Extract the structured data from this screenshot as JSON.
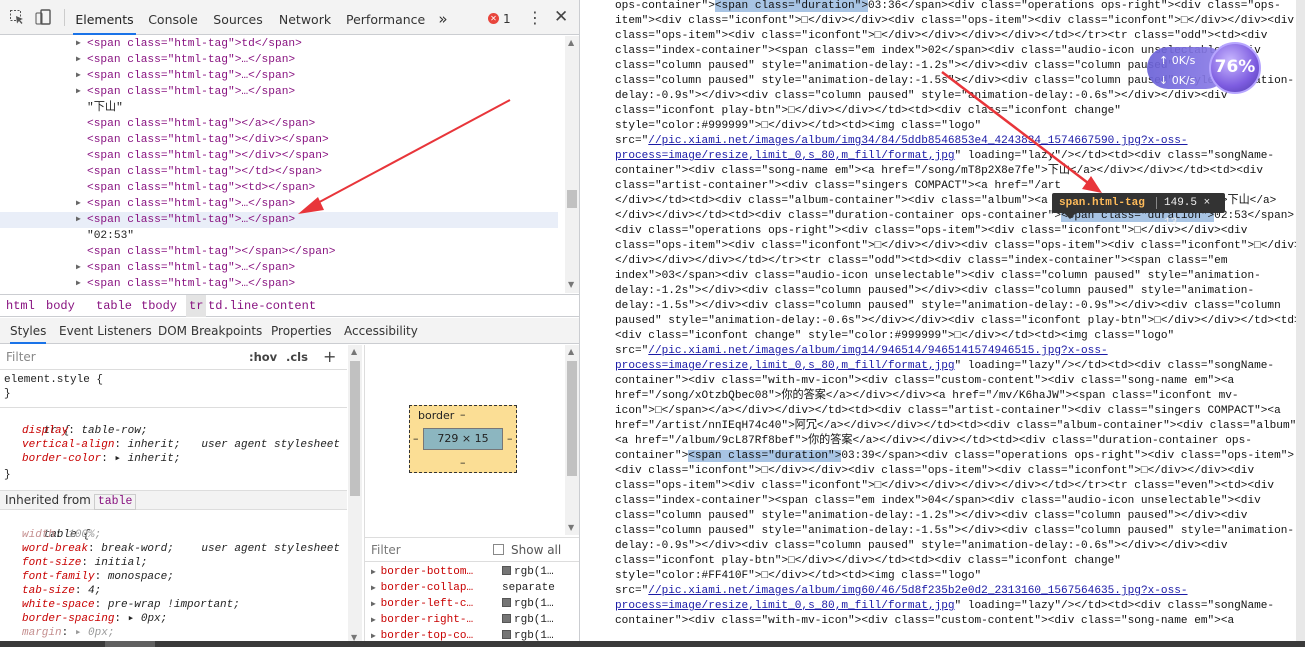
{
  "toolbar": {
    "inspect_icon": "cursor-select-icon",
    "device_icon": "device-toggle-icon",
    "tabs": [
      "Elements",
      "Console",
      "Sources",
      "Network",
      "Performance"
    ],
    "more": "»",
    "error_count": "1",
    "error_glyph": "✕",
    "menu": "⋮",
    "close": "✕"
  },
  "elements": {
    "rows": [
      {
        "tri": "▶",
        "text": "<span class=\"html-tag\">td</span>"
      },
      {
        "tri": "▶",
        "text": "<span class=\"html-tag\">…</span>"
      },
      {
        "tri": "▶",
        "text": "<span class=\"html-tag\">…</span>"
      },
      {
        "tri": "▶",
        "text": "<span class=\"html-tag\">…</span>"
      },
      {
        "tri": "",
        "text": "\"下山\""
      },
      {
        "tri": "",
        "text": "<span class=\"html-tag\"></a></span>"
      },
      {
        "tri": "",
        "text": "<span class=\"html-tag\"></div></span>"
      },
      {
        "tri": "",
        "text": "<span class=\"html-tag\"></div></span>"
      },
      {
        "tri": "",
        "text": "<span class=\"html-tag\"></td></span>"
      },
      {
        "tri": "",
        "text": "<span class=\"html-tag\"><td></span>"
      },
      {
        "tri": "▶",
        "text": "<span class=\"html-tag\">…</span>"
      },
      {
        "tri": "▶",
        "text": "<span class=\"html-tag\">…</span>"
      },
      {
        "tri": "",
        "text": "\"02:53\""
      },
      {
        "tri": "",
        "text": "<span class=\"html-tag\"></span></span>"
      },
      {
        "tri": "▶",
        "text": "<span class=\"html-tag\">…</span>"
      },
      {
        "tri": "▶",
        "text": "<span class=\"html-tag\">…</span>"
      }
    ],
    "selected_index": 11
  },
  "breadcrumbs": [
    "html",
    "body",
    "table",
    "tbody",
    "tr",
    "td.line-content"
  ],
  "breadcrumb_selected": 4,
  "subtabs": [
    "Styles",
    "Event Listeners",
    "DOM Breakpoints",
    "Properties",
    "Accessibility"
  ],
  "styles": {
    "filter_placeholder": "Filter",
    "hov": ":hov",
    "cls": ".cls",
    "plus": "+",
    "element_style_open": "element.style {",
    "close_brace": "}",
    "tr_rule": {
      "selector": "tr {",
      "source": "user agent stylesheet",
      "props": [
        {
          "name": "display",
          "value": "table-row;"
        },
        {
          "name": "vertical-align",
          "value": "inherit;"
        },
        {
          "name": "border-color",
          "value": "▸ inherit;"
        }
      ]
    },
    "inherited_from_label": "Inherited from",
    "inherited_from_tag": "table",
    "table_rule": {
      "selector": "table {",
      "source": "user agent stylesheet",
      "props": [
        {
          "name": "width",
          "value": "100%;",
          "disabled": true
        },
        {
          "name": "word-break",
          "value": "break-word;"
        },
        {
          "name": "font-size",
          "value": "initial;"
        },
        {
          "name": "font-family",
          "value": "monospace;"
        },
        {
          "name": "tab-size",
          "value": "4;"
        },
        {
          "name": "white-space",
          "value": "pre-wrap !important;"
        },
        {
          "name": "border-spacing",
          "value": "▸ 0px;"
        },
        {
          "name": "margin",
          "value": "▸ 0px;",
          "disabled": true
        }
      ]
    }
  },
  "box_model": {
    "label": "border",
    "dash": "–",
    "content": "729 × 15"
  },
  "computed": {
    "filter_placeholder": "Filter",
    "show_all": "Show all",
    "props": [
      {
        "name": "border-bottom…",
        "value": "rgb(1…",
        "swatch": true
      },
      {
        "name": "border-collap…",
        "value": "separate",
        "swatch": false
      },
      {
        "name": "border-left-c…",
        "value": "rgb(1…",
        "swatch": true
      },
      {
        "name": "border-right-…",
        "value": "rgb(1…",
        "swatch": true
      },
      {
        "name": "border-top-co…",
        "value": "rgb(1…",
        "swatch": true
      }
    ]
  },
  "source_lines": [
    "ops-container\"><span class=\"duration\">03:36</span><div class=\"operations ops-right\"><div class=\"ops-",
    "item\"><div class=\"iconfont\">□</div></div><div class=\"ops-item\"><div class=\"iconfont\">□</div></div><div",
    "class=\"ops-item\"><div class=\"iconfont\">□</div></div></div></div></td></tr><tr class=\"odd\"><td><div",
    "class=\"index-container\"><span class=\"em index\">02</span><div class=\"audio-icon unselectable\"><div",
    "class=\"column paused\" style=\"animation-delay:-1.2s\"></div><div class=\"column paused\"",
    "class=\"column paused\" style=\"animation-delay:-1.5s\"></div><div class=\"column paused\" style=\"animation-",
    "delay:-0.9s\"></div><div class=\"column paused\" style=\"animation-delay:-0.6s\"></div></div><div",
    "class=\"iconfont play-btn\">□</div></div></td><td><div class=\"iconfont change\"",
    "style=\"color:#999999\">□</div></td><td><img class=\"logo\"",
    "src=\"//pic.xiami.net/images/album/img34/84/5ddb8546853e4_4243834_1574667590.jpg?x-oss-",
    "process=image/resize,limit_0,s_80,m_fill/format,jpg\" loading=\"lazy\"/></td><td><div class=\"songName-",
    "container\"><div class=\"song-name em\"><a href=\"/song/mT8p2X8e7fe\">下山</a></div></div></td><td><div",
    "class=\"artist-container\"><div class=\"singers COMPACT\"><a href=\"/art",
    "</div></td><td><div class=\"album-container\"><div class=\"album\"><a href=\"/album/yr84u69d2ee\">下山</a>",
    "</div></div></td><td><div class=\"duration-container ops-container\"><span class=\"duration\">02:53</span>",
    "<div class=\"operations ops-right\"><div class=\"ops-item\"><div class=\"iconfont\">□</div></div><div",
    "class=\"ops-item\"><div class=\"iconfont\">□</div></div><div class=\"ops-item\"><div class=\"iconfont\">□</div>",
    "</div></div></div></td></tr><tr class=\"odd\"><td><div class=\"index-container\"><span class=\"em",
    "index\">03</span><div class=\"audio-icon unselectable\"><div class=\"column paused\" style=\"animation-",
    "delay:-1.2s\"></div><div class=\"column paused\"></div><div class=\"column paused\" style=\"animation-",
    "delay:-1.5s\"></div><div class=\"column paused\" style=\"animation-delay:-0.9s\"></div><div class=\"column",
    "paused\" style=\"animation-delay:-0.6s\"></div></div><div class=\"iconfont play-btn\">□</div></div></td><td>",
    "<div class=\"iconfont change\" style=\"color:#999999\">□</div></td><td><img class=\"logo\"",
    "src=\"//pic.xiami.net/images/album/img14/946514/9465141574946515.jpg?x-oss-",
    "process=image/resize,limit_0,s_80,m_fill/format,jpg\" loading=\"lazy\"/></td><td><div class=\"songName-",
    "container\"><div class=\"with-mv-icon\"><div class=\"custom-content\"><div class=\"song-name em\"><a",
    "href=\"/song/xOtzbQbec08\">你的答案</a></div></div><a href=\"/mv/K6haJW\"><span class=\"iconfont mv-",
    "icon\">□</span></a></div></div></td><td><div class=\"artist-container\"><div class=\"singers COMPACT\"><a",
    "href=\"/artist/nnIEqH74c40\">阿冗</a></div></div></td><td><div class=\"album-container\"><div class=\"album\">",
    "<a href=\"/album/9cL87Rf8bef\">你的答案</a></div></div></td><td><div class=\"duration-container ops-",
    "container\"><span class=\"duration\">03:39</span><div class=\"operations ops-right\"><div class=\"ops-item\">",
    "<div class=\"iconfont\">□</div></div><div class=\"ops-item\"><div class=\"iconfont\">□</div></div><div",
    "class=\"ops-item\"><div class=\"iconfont\">□</div></div></div></div></td></tr><tr class=\"even\"><td><div",
    "class=\"index-container\"><span class=\"em index\">04</span><div class=\"audio-icon unselectable\"><div",
    "class=\"column paused\" style=\"animation-delay:-1.2s\"></div><div class=\"column paused\"></div><div",
    "class=\"column paused\" style=\"animation-delay:-1.5s\"></div><div class=\"column paused\" style=\"animation-",
    "delay:-0.9s\"></div><div class=\"column paused\" style=\"animation-delay:-0.6s\"></div></div><div",
    "class=\"iconfont play-btn\">□</div></div></td><td><div class=\"iconfont change\"",
    "style=\"color:#FF410F\">□</div></td><td><img class=\"logo\"",
    "src=\"//pic.xiami.net/images/album/img60/46/5d8f235b2e0d2_2313160_1567564635.jpg?x-oss-",
    "process=image/resize,limit_0,s_80,m_fill/format,jpg\" loading=\"lazy\"/></td><td><div class=\"songName-",
    "container\"><div class=\"with-mv-icon\"><div class=\"custom-content\"><div class=\"song-name em\"><a"
  ],
  "source_highlight": "<span class=\"duration\">",
  "tooltip": {
    "name": "span.html-tag",
    "size": "149.5 × 13"
  },
  "speed_widget": {
    "up": "0K/s",
    "down": "0K/s",
    "percent": "76%"
  },
  "colors": {
    "arrow": "#e8353a",
    "accent": "#1a73e8"
  }
}
